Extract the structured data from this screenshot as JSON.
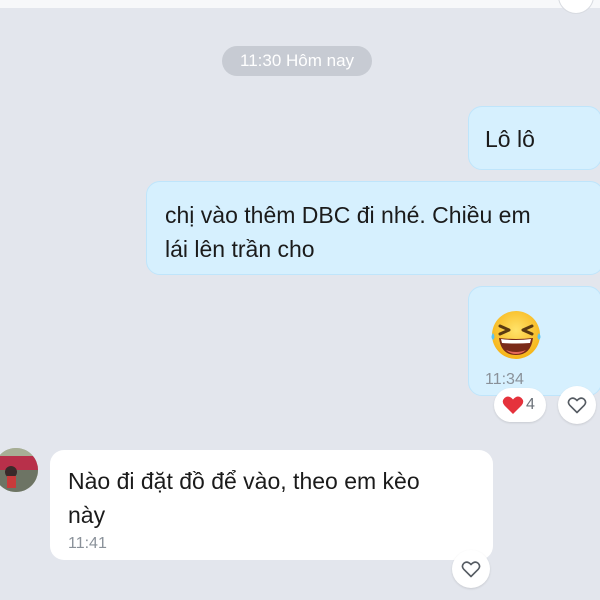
{
  "time_separator": "11:30 Hôm nay",
  "messages": [
    {
      "direction": "outgoing",
      "text": "Lô lô"
    },
    {
      "direction": "outgoing",
      "lines": [
        "chị vào thêm DBC đi nhé. Chiều em",
        "lái lên trần cho"
      ]
    },
    {
      "direction": "outgoing",
      "emoji": "grinning-squinting-face",
      "time": "11:34",
      "reaction": {
        "icon": "heart-icon",
        "count": "4"
      }
    },
    {
      "direction": "incoming",
      "lines": [
        "Nào đi đặt đồ để vào, theo em kèo",
        "này"
      ],
      "time": "11:41"
    }
  ],
  "colors": {
    "background": "#e3e6ed",
    "outgoing_bubble": "#d6f0fe",
    "incoming_bubble": "#ffffff",
    "time_text": "#8a9199",
    "heart": "#e5323c"
  }
}
